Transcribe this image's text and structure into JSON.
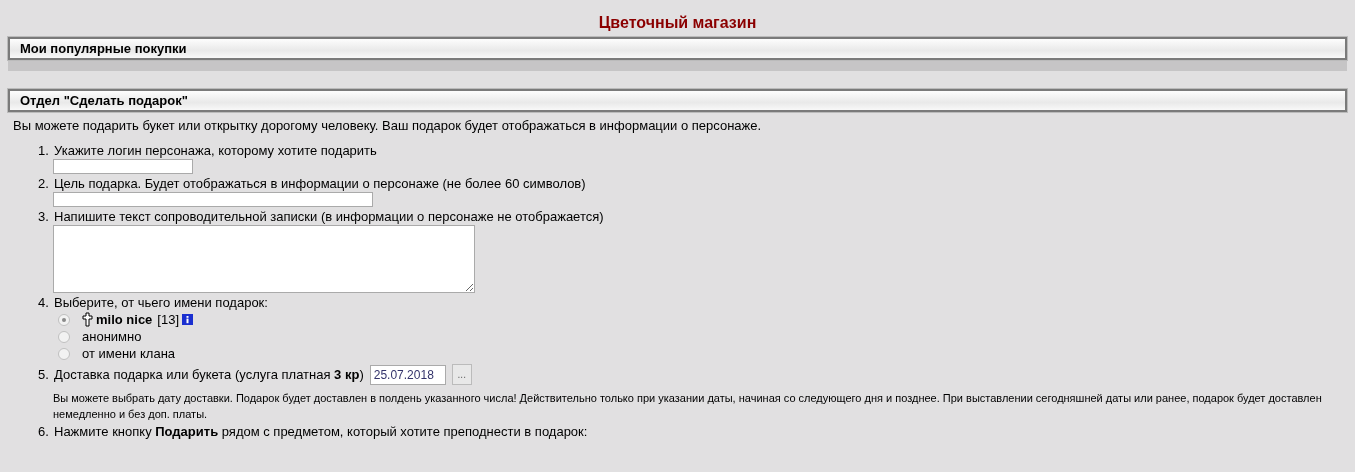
{
  "title": "Цветочный магазин",
  "sections": [
    {
      "kind": "list",
      "heading": "Мои популярные покупки"
    },
    {
      "kind": "form",
      "heading": "Отдел \"Сделать подарок\""
    }
  ],
  "intro": "Вы можете подарить букет или открытку дорогому человеку. Ваш подарок будет отображаться в информации о персонаже.",
  "steps": [
    {
      "kind": "input",
      "number": "1.",
      "label": "Укажите логин персонажа, которому хотите подарить"
    },
    {
      "kind": "wideinput",
      "number": "2.",
      "label": "Цель подарка. Будет отображаться в информации о персонаже (не более 60 символов)"
    },
    {
      "kind": "textarea",
      "number": "3.",
      "label": "Напишите текст сопроводительной записки (в информации о персонаже не отображается)"
    },
    {
      "kind": "radio",
      "number": "4.",
      "label": "Выберите, от чьего имени подарок:",
      "options": [
        {
          "kind": "character",
          "name": "milo nice",
          "level": "[13]",
          "selected": true
        },
        {
          "kind": "text",
          "label": "анонимно",
          "selected": false
        },
        {
          "kind": "text",
          "label": "от имени клана",
          "selected": false
        }
      ]
    },
    {
      "kind": "date",
      "number": "5.",
      "label": "Доставка подарка или букета (услуга платная **3 кр**)",
      "value": "25.07.2018",
      "button": "...",
      "note": "Вы можете выбрать дату доставки. Подарок будет доставлен в полдень указанного числа! Действительно только при указании даты, начиная со следующего дня и позднее. При выставлении сегодняшней даты или ранее, подарок будет доставлен немедленно и без доп. платы."
    },
    {
      "kind": "text",
      "number": "6.",
      "label": "Нажмите кнопку **Подарить** рядом с предметом, который хотите преподнести в подарок:"
    }
  ]
}
